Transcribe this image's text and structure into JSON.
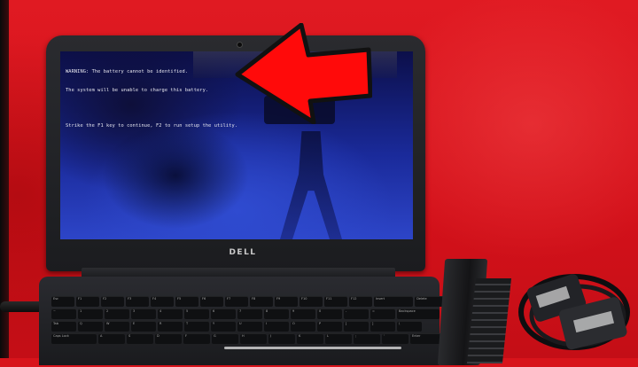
{
  "scene": {
    "description_colors": {
      "background": "#d8141b",
      "screen": "#1a2a9a",
      "arrow": "#ff0a0a",
      "laptop_body": "#1b1c1f"
    }
  },
  "screen_text": {
    "line1": "WARNING: The battery cannot be identified.",
    "line2": "The system will be unable to charge this battery.",
    "line3": "Strike the F1 key to continue, F2 to run setup the utility."
  },
  "laptop": {
    "brand": "DELL"
  },
  "keyboard": {
    "row1": [
      "Esc",
      "F1",
      "F2",
      "F3",
      "F4",
      "F5",
      "F6",
      "F7",
      "F8",
      "F9",
      "F10",
      "F11",
      "F12",
      "Insert",
      "Delete"
    ],
    "row2_labels": [
      "~",
      "1",
      "2",
      "3",
      "4",
      "5",
      "6",
      "7",
      "8",
      "9",
      "0",
      "-",
      "=",
      "Backspace"
    ],
    "row3_labels": [
      "Tab",
      "Q",
      "W",
      "E",
      "R",
      "T",
      "Y",
      "U",
      "I",
      "O",
      "P",
      "[",
      "]",
      "\\"
    ],
    "row4_labels": [
      "Caps Lock",
      "A",
      "S",
      "D",
      "F",
      "G",
      "H",
      "J",
      "K",
      "L",
      ";",
      "'",
      "Enter"
    ]
  }
}
